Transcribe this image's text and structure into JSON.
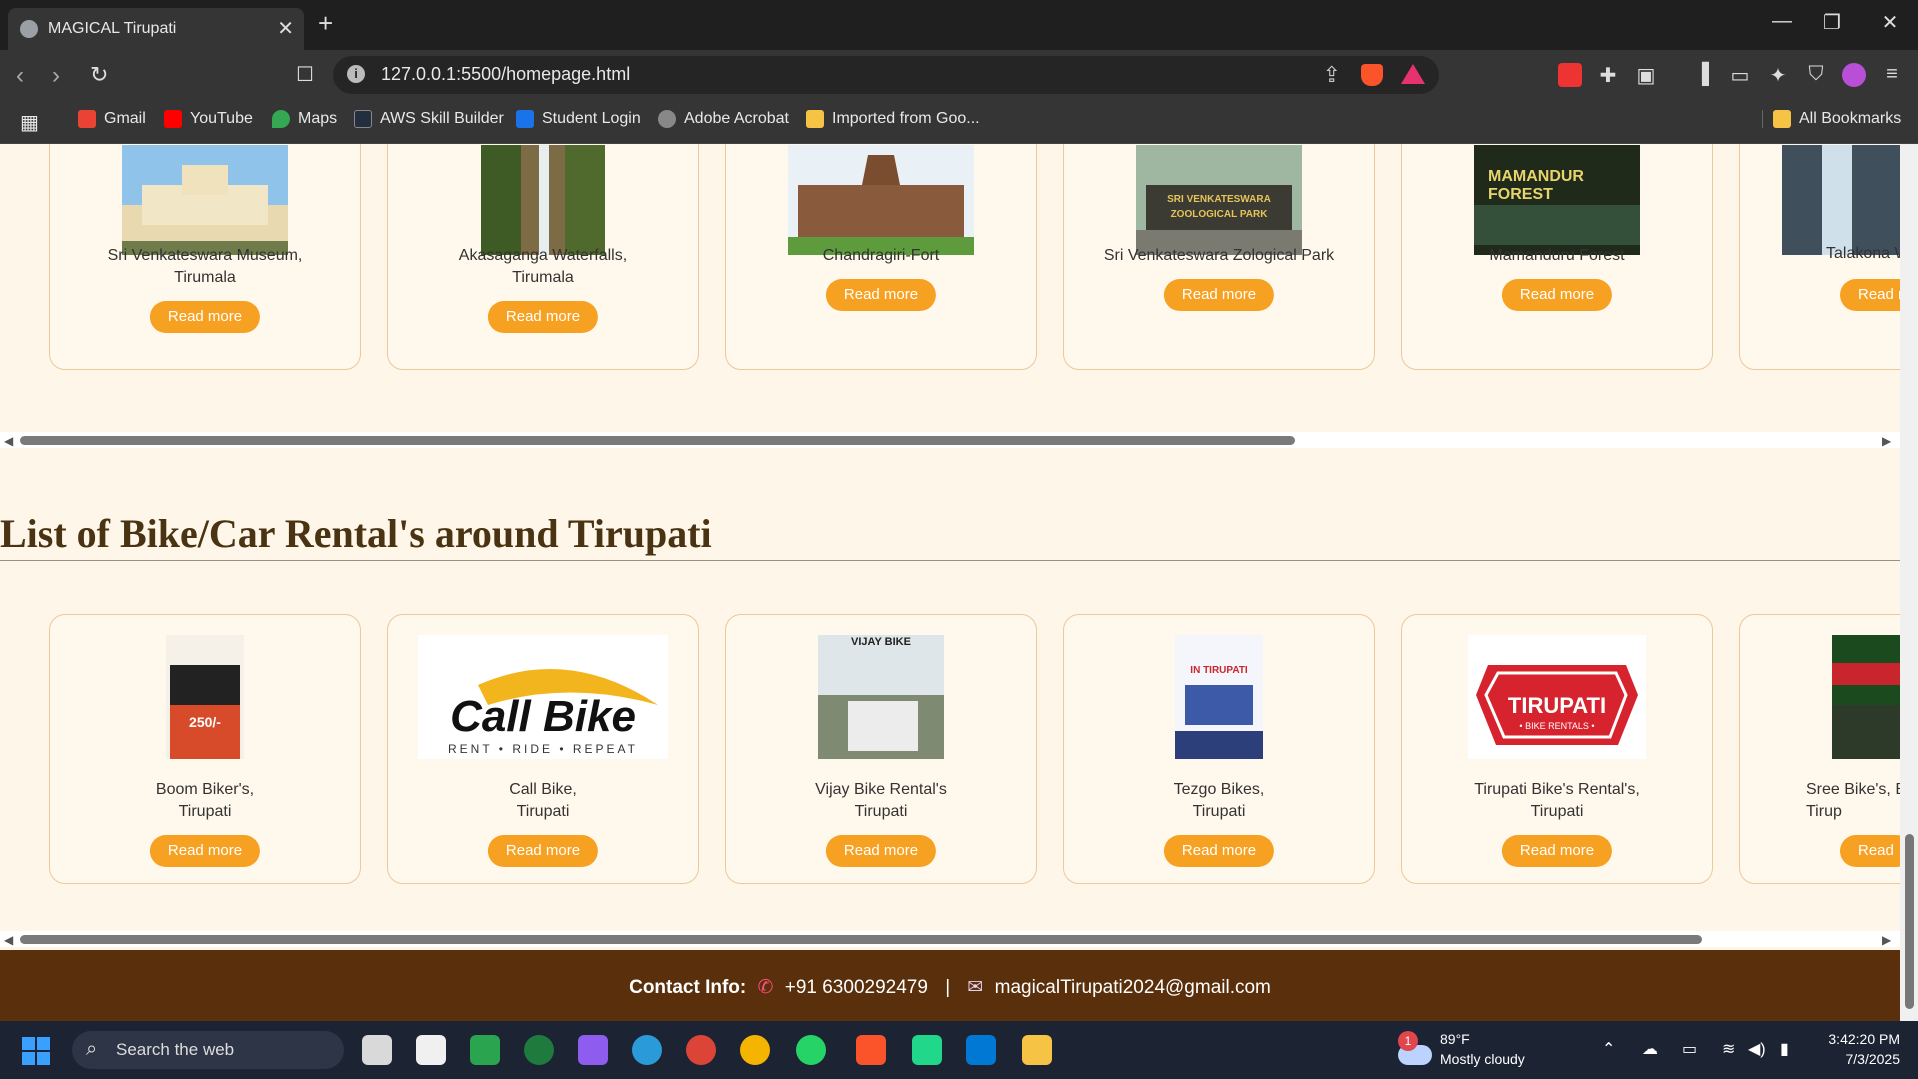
{
  "browser": {
    "tab_title": "MAGICAL Tirupati",
    "url": "127.0.0.1:5500/homepage.html",
    "bookmarks": [
      {
        "label": "Gmail",
        "color": "#ea4335"
      },
      {
        "label": "YouTube",
        "color": "#ff0000"
      },
      {
        "label": "Maps",
        "color": "#34a853"
      },
      {
        "label": "AWS Skill Builder",
        "color": "#232f3e"
      },
      {
        "label": "Student Login",
        "color": "#1a73e8"
      },
      {
        "label": "Adobe Acrobat",
        "color": "#888888"
      },
      {
        "label": "Imported from Goo...",
        "color": "#f6c344"
      }
    ],
    "all_bookmarks": "All Bookmarks"
  },
  "places_row": [
    {
      "name": "Sri Venkateswara Museum,\nTirumala",
      "button": "Read more",
      "image": "museum-image"
    },
    {
      "name": "Akasaganga Waterfalls,\nTirumala",
      "button": "Read more",
      "image": "waterfall-image"
    },
    {
      "name": "Chandragiri-Fort",
      "button": "Read more",
      "image": "fort-image"
    },
    {
      "name": "Sri Venkateswara Zological Park",
      "button": "Read more",
      "image": "zoo-image"
    },
    {
      "name": "Mamanduru Forest",
      "button": "Read more",
      "image": "forest-image"
    },
    {
      "name": "Talakona W",
      "button": "Read r",
      "image": "talakona-image"
    }
  ],
  "forest_sign": "MAMANDUR\nFOREST",
  "zoo_sign": "SRI VENKATESWARA\nZOOLOGICAL PARK",
  "rentals_title": "List of Bike/Car Rental's around Tirupati",
  "rentals_row": [
    {
      "name": "Boom Biker's,\nTirupati",
      "button": "Read more"
    },
    {
      "name": "Call Bike,\nTirupati",
      "button": "Read more"
    },
    {
      "name": "Vijay Bike Rental's\nTirupati",
      "button": "Read more"
    },
    {
      "name": "Tezgo Bikes,\nTirupati",
      "button": "Read more"
    },
    {
      "name": "Tirupati Bike's Rental's,\nTirupati",
      "button": "Read more"
    },
    {
      "name": "Sree Bike's, Bi\nTirup",
      "button": "Read "
    }
  ],
  "rental_logos": {
    "callbike": "Call Bike",
    "callbike_tag": "RENT • RIDE • REPEAT",
    "tirupati": "TIRUPATI",
    "tirupati_tag": "• BIKE RENTALS •",
    "tezgo": "IN TIRUPATI",
    "boom": "250/-",
    "vijay": "VIJAY BIKE"
  },
  "footer": {
    "label": "Contact Info:",
    "phone": "+91 6300292479",
    "separator": "|",
    "email": "magicalTirupati2024@gmail.com"
  },
  "taskbar": {
    "search_placeholder": "Search the web",
    "weather_badge": "1",
    "temperature": "89°F",
    "condition": "Mostly cloudy",
    "time": "3:42:20 PM",
    "date": "7/3/2025"
  }
}
